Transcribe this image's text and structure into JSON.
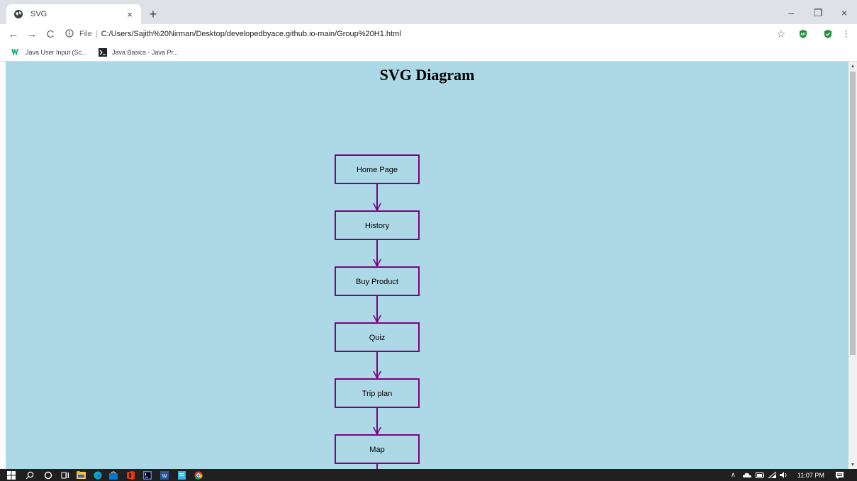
{
  "browser": {
    "tab_title": "SVG",
    "tab_close": "×",
    "new_tab": "+",
    "window_controls": {
      "minimize": "–",
      "maximize": "❐",
      "close": "×"
    }
  },
  "toolbar": {
    "back": "←",
    "forward": "→",
    "reload": "C",
    "address_scheme": "File",
    "address_separator": "|",
    "address_path": "C:/Users/Sajith%20Nirman/Desktop/developedbyace.github.io-main/Group%20H1.html",
    "bookmark_star": "☆",
    "extension_badge": "AD",
    "menu": "⋮"
  },
  "bookmarks": [
    {
      "label": "Java User Input (Sc...",
      "icon": "w3schools-icon"
    },
    {
      "label": "Java Basics - Java Pr...",
      "icon": "terminal-icon"
    }
  ],
  "page": {
    "title": "SVG Diagram",
    "background": "#add8e6",
    "stroke_color": "#800080",
    "flow_nodes": [
      "Home Page",
      "History",
      "Buy Product",
      "Quiz",
      "Trip plan",
      "Map"
    ]
  },
  "scrollbar": {
    "up": "▲",
    "down": "▼"
  },
  "taskbar": {
    "clock": "11:07 PM",
    "tray_arrow": "∧"
  }
}
